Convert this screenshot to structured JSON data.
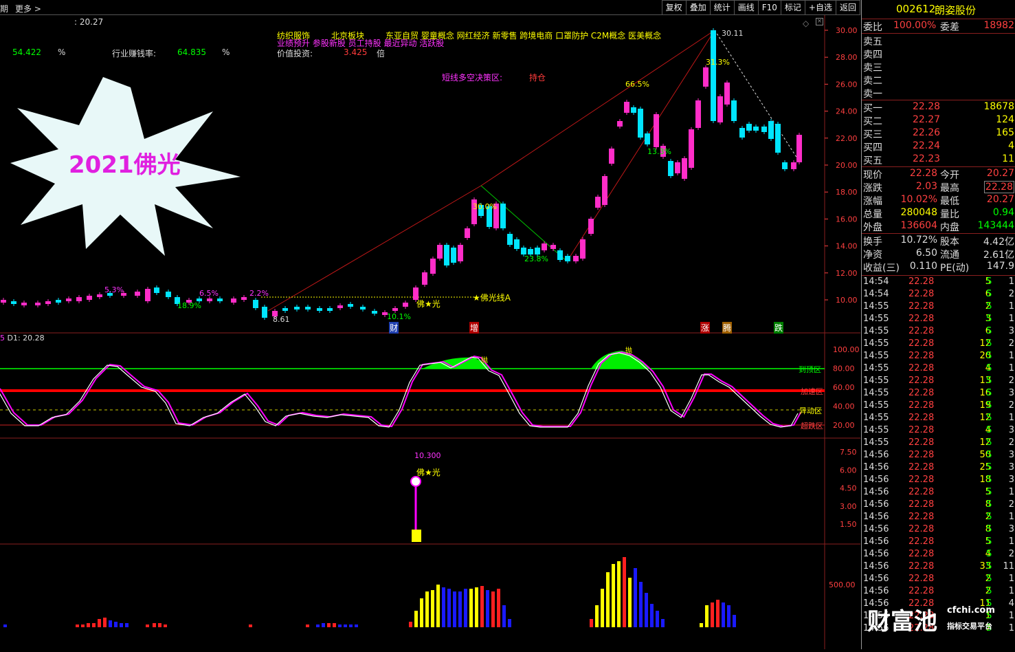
{
  "topbar": {
    "period": "期",
    "more": "更多",
    "more_arrow": ">"
  },
  "toolbar": [
    "复权",
    "叠加",
    "统计",
    "画线",
    "F10",
    "标记",
    "+自选",
    "返回"
  ],
  "main": {
    "last_value": ": 20.27",
    "metric1_value": "54.422",
    "metric1_unit": "%",
    "metric2_label": "行业赚钱率:",
    "metric2_value": "64.835",
    "metric2_unit": "%",
    "tags1": [
      "纺织服饰",
      "北京板块",
      "东亚自贸 婴童概念 网红经济 新零售 跨境电商 口罩防护 C2M概念 医美概念"
    ],
    "tags2": "业绩预升 参股新股 员工持股 最近异动 活跃股",
    "value_label": "价值投资:",
    "value_num": "3.425",
    "value_unit": "倍",
    "decision_label": "短线多空决策区:",
    "decision_value": "持仓",
    "burst_text": "2021佛光",
    "annotations": [
      "30.11",
      "31.3%",
      "66.5%",
      "13.3%",
      "30.0%",
      "23.8%",
      "5.3%",
      "6.5%",
      "2.2%",
      "18.9%",
      "8.61",
      "10.1%",
      "佛★光",
      "★佛光线A"
    ],
    "markers": [
      "财",
      "增",
      "涨",
      "腾",
      "跌"
    ],
    "yaxis": [
      "30.00",
      "28.00",
      "26.00",
      "24.00",
      "22.00",
      "20.00",
      "18.00",
      "16.00",
      "14.00",
      "12.00",
      "10.00"
    ]
  },
  "kd": {
    "label": "D1: 20.28",
    "label_prefix": "5",
    "yaxis": [
      "100.00",
      "80.00",
      "60.00",
      "40.00",
      "20.00"
    ],
    "zones": [
      "到顶区",
      "加速区",
      "异动区",
      "超跌区"
    ],
    "peaks": "抛"
  },
  "sig": {
    "value": "10.300",
    "label": "佛★光",
    "yaxis": [
      "7.50",
      "6.00",
      "4.50",
      "3.00",
      "1.50"
    ]
  },
  "vol": {
    "yaxis": "500.00"
  },
  "quote": {
    "code": "002612",
    "name": "朗姿股份",
    "wb_label": "委比",
    "wb_value": "100.00%",
    "wc_label": "委差",
    "wc_value": "18982",
    "sells": [
      "卖五",
      "卖四",
      "卖三",
      "卖二",
      "卖一"
    ],
    "buys": [
      {
        "l": "买一",
        "p": "22.28",
        "v": "18678"
      },
      {
        "l": "买二",
        "p": "22.27",
        "v": "124"
      },
      {
        "l": "买三",
        "p": "22.26",
        "v": "165"
      },
      {
        "l": "买四",
        "p": "22.24",
        "v": "4"
      },
      {
        "l": "买五",
        "p": "22.23",
        "v": "11"
      }
    ],
    "stats": [
      {
        "l1": "现价",
        "v1": "22.28",
        "l2": "今开",
        "v2": "20.27"
      },
      {
        "l1": "涨跌",
        "v1": "2.03",
        "l2": "最高",
        "v2": "22.28"
      },
      {
        "l1": "涨幅",
        "v1": "10.02%",
        "l2": "最低",
        "v2": "20.27"
      },
      {
        "l1": "总量",
        "v1": "280048",
        "l2": "量比",
        "v2": "0.94"
      },
      {
        "l1": "外盘",
        "v1": "136604",
        "l2": "内盘",
        "v2": "143444"
      }
    ],
    "fin": [
      {
        "l1": "换手",
        "v1": "10.72%",
        "l2": "股本",
        "v2": "4.42亿"
      },
      {
        "l1": "净资",
        "v1": "6.50",
        "l2": "流通",
        "v2": "2.61亿"
      },
      {
        "l1": "收益(三)",
        "v1": "0.110",
        "l2": "PE(动)",
        "v2": "147.9"
      }
    ],
    "ticks": [
      [
        "14:54",
        "22.28",
        "5",
        "S",
        "1"
      ],
      [
        "14:54",
        "22.28",
        "6",
        "S",
        "2"
      ],
      [
        "14:55",
        "22.28",
        "2",
        "S",
        "1"
      ],
      [
        "14:55",
        "22.28",
        "3",
        "S",
        "1"
      ],
      [
        "14:55",
        "22.28",
        "6",
        "S",
        "3"
      ],
      [
        "14:55",
        "22.28",
        "12",
        "S",
        "2"
      ],
      [
        "14:55",
        "22.28",
        "20",
        "S",
        "1"
      ],
      [
        "14:55",
        "22.28",
        "4",
        "S",
        "1"
      ],
      [
        "14:55",
        "22.28",
        "13",
        "S",
        "2"
      ],
      [
        "14:55",
        "22.28",
        "16",
        "S",
        "3"
      ],
      [
        "14:55",
        "22.28",
        "19",
        "S",
        "2"
      ],
      [
        "14:55",
        "22.28",
        "12",
        "S",
        "1"
      ],
      [
        "14:55",
        "22.28",
        "4",
        "S",
        "3"
      ],
      [
        "14:55",
        "22.28",
        "12",
        "S",
        "2"
      ],
      [
        "14:56",
        "22.28",
        "50",
        "S",
        "3"
      ],
      [
        "14:56",
        "22.28",
        "25",
        "S",
        "3"
      ],
      [
        "14:56",
        "22.28",
        "18",
        "S",
        "3"
      ],
      [
        "14:56",
        "22.28",
        "5",
        "S",
        "1"
      ],
      [
        "14:56",
        "22.28",
        "8",
        "S",
        "2"
      ],
      [
        "14:56",
        "22.28",
        "2",
        "S",
        "1"
      ],
      [
        "14:56",
        "22.28",
        "8",
        "S",
        "3"
      ],
      [
        "14:56",
        "22.28",
        "5",
        "S",
        "1"
      ],
      [
        "14:56",
        "22.28",
        "4",
        "S",
        "2"
      ],
      [
        "14:56",
        "22.28",
        "33",
        "S",
        "11"
      ],
      [
        "14:56",
        "22.28",
        "2",
        "S",
        "1"
      ],
      [
        "14:56",
        "22.28",
        "2",
        "S",
        "1"
      ],
      [
        "14:56",
        "22.28",
        "11",
        "S",
        "4"
      ],
      [
        "14:56",
        "22.28",
        "1",
        "S",
        "1"
      ],
      [
        "14:56",
        "22.28",
        "7",
        "S",
        "1"
      ]
    ]
  },
  "logo": {
    "main": "财富池",
    "site": "cfchi.com",
    "sub": "指标交易平台"
  },
  "colors": {
    "up": "#ff2dc8",
    "down": "#00e5ff",
    "bg": "#000000",
    "price": "#ff3b3b",
    "green": "#00ff00",
    "yellow": "#ffff00"
  }
}
